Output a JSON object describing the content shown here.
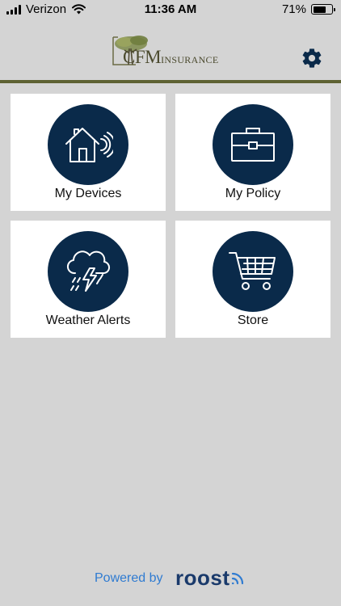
{
  "status_bar": {
    "carrier": "Verizon",
    "time": "11:36 AM",
    "battery_percent": "71%",
    "battery_level": 0.71
  },
  "header": {
    "logo_cfm": "CFM",
    "logo_insurance": "INSURANCE",
    "settings_icon": "gear-icon",
    "accent_color": "#5e6233"
  },
  "tiles": [
    {
      "label": "My Devices",
      "icon": "smart-home-icon"
    },
    {
      "label": "My Policy",
      "icon": "briefcase-icon"
    },
    {
      "label": "Weather Alerts",
      "icon": "storm-cloud-icon"
    },
    {
      "label": "Store",
      "icon": "shopping-cart-icon"
    }
  ],
  "footer": {
    "powered_by": "Powered by",
    "brand": "roost"
  },
  "colors": {
    "background": "#d4d4d4",
    "tile_background": "#ffffff",
    "icon_circle": "#0a2a4a",
    "powered_text": "#2f7bd1",
    "brand_text": "#1a3a6b"
  }
}
